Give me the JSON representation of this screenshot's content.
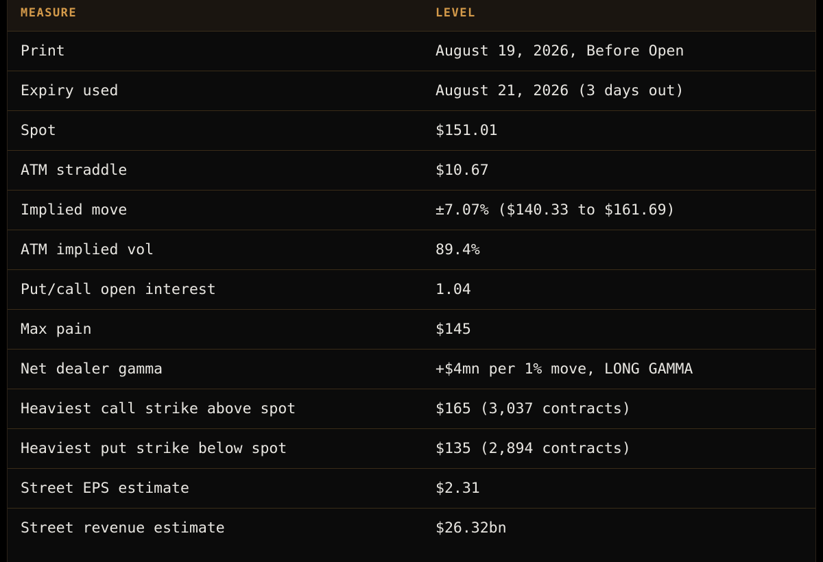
{
  "headers": {
    "measure": "MEASURE",
    "level": "LEVEL"
  },
  "rows": [
    {
      "measure": "Print",
      "level": "August 19, 2026, Before Open"
    },
    {
      "measure": "Expiry used",
      "level": "August 21, 2026 (3 days out)"
    },
    {
      "measure": "Spot",
      "level": "$151.01"
    },
    {
      "measure": "ATM straddle",
      "level": "$10.67"
    },
    {
      "measure": "Implied move",
      "level": "±7.07% ($140.33 to $161.69)"
    },
    {
      "measure": "ATM implied vol",
      "level": "89.4%"
    },
    {
      "measure": "Put/call open interest",
      "level": "1.04"
    },
    {
      "measure": "Max pain",
      "level": "$145"
    },
    {
      "measure": "Net dealer gamma",
      "level": "+$4mn per 1% move, LONG GAMMA"
    },
    {
      "measure": "Heaviest call strike above spot",
      "level": "$165 (3,037 contracts)"
    },
    {
      "measure": "Heaviest put strike below spot",
      "level": "$135 (2,894 contracts)"
    },
    {
      "measure": "Street EPS estimate",
      "level": "$2.31"
    },
    {
      "measure": "Street revenue estimate",
      "level": "$26.32bn"
    }
  ],
  "colors": {
    "header_text": "#d49a4a",
    "body_text": "#e8e6e1",
    "row_divider": "#3a2c18",
    "background": "#0b0b0b"
  }
}
